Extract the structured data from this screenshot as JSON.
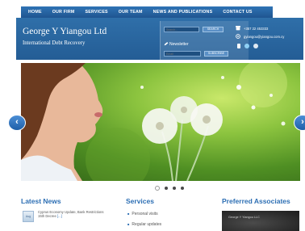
{
  "nav": {
    "items": [
      "HOME",
      "OUR FIRM",
      "SERVICES",
      "OUR TEAM",
      "NEWS AND PUBLICATIONS",
      "CONTACT US"
    ]
  },
  "header": {
    "brand": "George Y Yiangou Ltd",
    "tagline": "International Debt Recovery",
    "search_placeholder": "Search...",
    "search_button": "SEARCH",
    "newsletter_label": "Newsletter",
    "email_placeholder": "Email",
    "subscribe_button": "SUBSCRIBE",
    "phone": "+357 22 453333",
    "email": "gyiangou@yiangou.com.cy"
  },
  "slider": {
    "slides_total": 4,
    "active_slide": 1
  },
  "sections": {
    "latest_news": {
      "title": "Latest News",
      "thumb_label": "Aug",
      "item_text": "Cyprus Economy Update, Bank Restrictions 15th Decree",
      "item_more": "[...]"
    },
    "services": {
      "title": "Services",
      "items": [
        "Personal visits",
        "Regular updates"
      ]
    },
    "associates": {
      "title": "Preferred Associates",
      "box_label": "George Y Yiangou LLC"
    }
  },
  "colors": {
    "nav_bar": "#2f73b5",
    "header_bg": "#2f6fa9",
    "section_title": "#2d6fb4"
  },
  "icons": [
    "phone-icon",
    "email-icon",
    "pencil-icon",
    "arrow-left-icon",
    "arrow-right-icon"
  ]
}
